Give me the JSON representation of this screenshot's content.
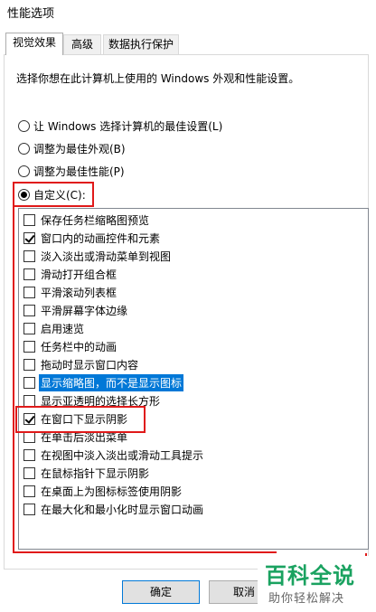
{
  "window": {
    "title": "性能选项"
  },
  "tabs": [
    {
      "label": "视觉效果",
      "active": true
    },
    {
      "label": "高级",
      "active": false
    },
    {
      "label": "数据执行保护",
      "active": false
    }
  ],
  "description": "选择你想在此计算机上使用的 Windows 外观和性能设置。",
  "radios": [
    {
      "label": "让 Windows 选择计算机的最佳设置(L)",
      "checked": false
    },
    {
      "label": "调整为最佳外观(B)",
      "checked": false
    },
    {
      "label": "调整为最佳性能(P)",
      "checked": false
    },
    {
      "label": "自定义(C):",
      "checked": true
    }
  ],
  "options": [
    {
      "label": "保存任务栏缩略图预览",
      "checked": false
    },
    {
      "label": "窗口内的动画控件和元素",
      "checked": true
    },
    {
      "label": "淡入淡出或滑动菜单到视图",
      "checked": false
    },
    {
      "label": "滑动打开组合框",
      "checked": false
    },
    {
      "label": "平滑滚动列表框",
      "checked": false
    },
    {
      "label": "平滑屏幕字体边缘",
      "checked": false
    },
    {
      "label": "启用速览",
      "checked": false
    },
    {
      "label": "任务栏中的动画",
      "checked": false
    },
    {
      "label": "拖动时显示窗口内容",
      "checked": false
    },
    {
      "label": "显示缩略图，而不是显示图标",
      "checked": false,
      "selected": true
    },
    {
      "label": "显示亚透明的选择长方形",
      "checked": false
    },
    {
      "label": "在窗口下显示阴影",
      "checked": true
    },
    {
      "label": "在单击后淡出菜单",
      "checked": false
    },
    {
      "label": "在视图中淡入淡出或滑动工具提示",
      "checked": false
    },
    {
      "label": "在鼠标指针下显示阴影",
      "checked": false
    },
    {
      "label": "在桌面上为图标标签使用阴影",
      "checked": false
    },
    {
      "label": "在最大化和最小化时显示窗口动画",
      "checked": false
    }
  ],
  "buttons": {
    "ok": "确定",
    "cancel": "取消"
  },
  "watermark": {
    "title": "百科全说",
    "subtitle": "助你轻松解决"
  }
}
